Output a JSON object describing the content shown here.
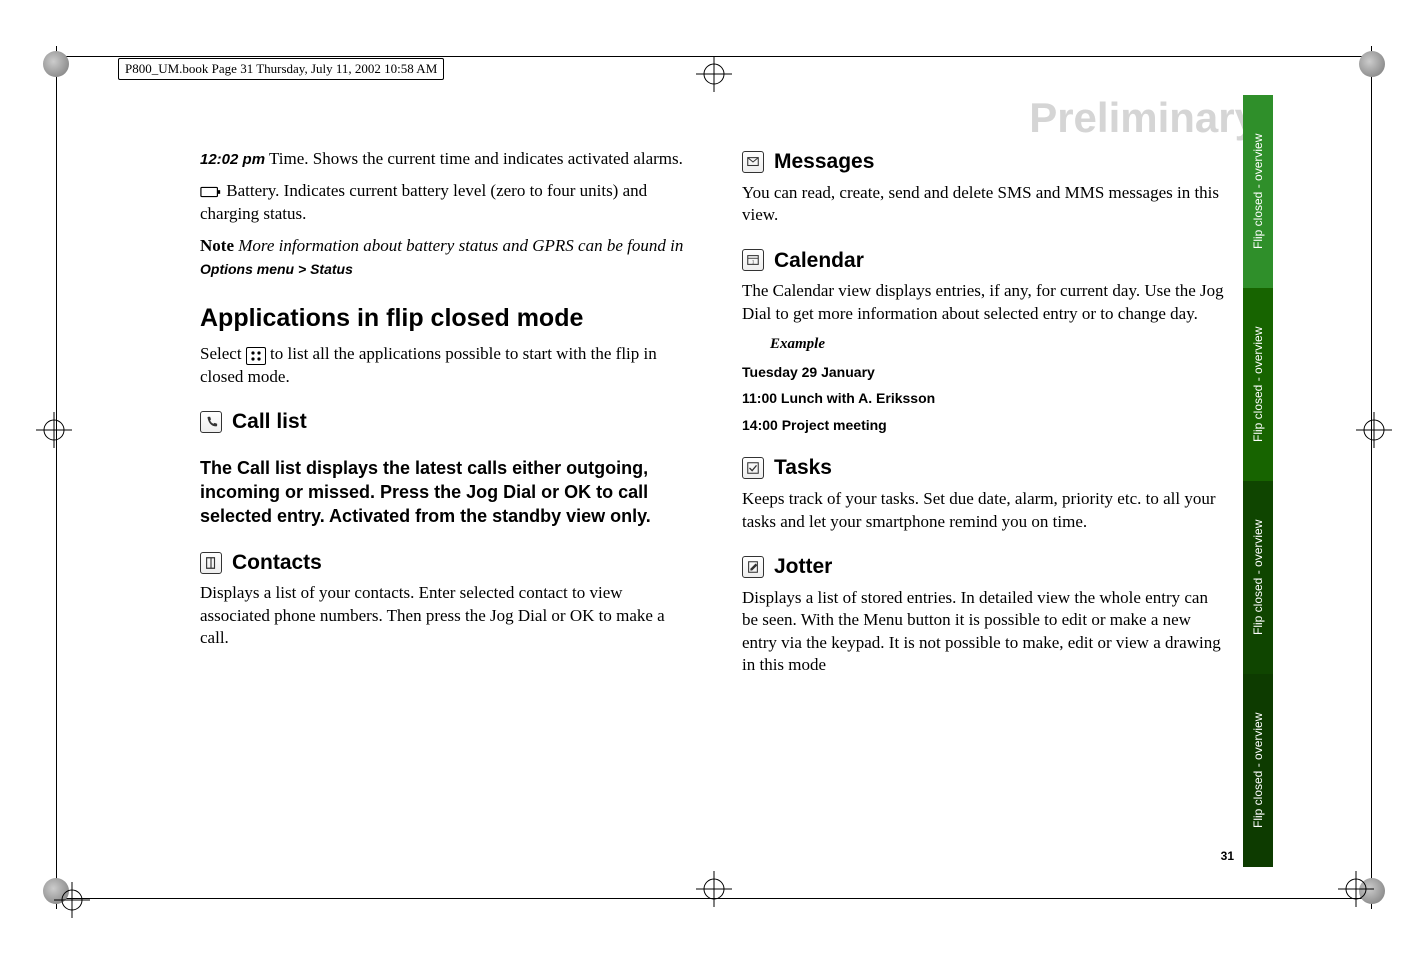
{
  "running_header": "P800_UM.book  Page 31  Thursday, July 11, 2002  10:58 AM",
  "watermark": "Preliminary",
  "page_number": "31",
  "side_tabs": {
    "t1": "Flip closed - overview",
    "t2": "Flip closed - overview",
    "t3": "Flip closed - overview",
    "t4": "Flip closed - overview"
  },
  "left": {
    "time_label": "12:02 pm",
    "time_text": " Time. Shows the current time and indicates activated alarms.",
    "battery_text": " Battery. Indicates current battery level (zero to four units) and charging status.",
    "note_word": "Note",
    "note_italic_a": " More information about battery status and GPRS can be found in ",
    "note_menu": "Options menu > Status",
    "h2": "Applications in flip closed mode",
    "select_a": "Select ",
    "select_b": " to list all the applications possible to start with the flip in closed mode.",
    "calllist_h": "Call list",
    "calllist_body": "The Call list displays the latest calls either outgoing, incoming or missed. Press the Jog Dial or OK to call selected entry. Activated from the standby view only.",
    "contacts_h": "Contacts",
    "contacts_body": "Displays a list of your contacts. Enter selected contact to view associated phone numbers. Then press the Jog Dial or OK to make a call."
  },
  "right": {
    "messages_h": "Messages",
    "messages_body": "You can read, create, send and delete SMS and MMS messages in this view.",
    "calendar_h": "Calendar",
    "calendar_body": "The Calendar view displays entries, if any, for current day. Use the Jog Dial to get more information about selected entry or to change day.",
    "example_label": "Example",
    "ex1": "Tuesday 29 January",
    "ex2": "11:00 Lunch with A. Eriksson",
    "ex3": "14:00 Project meeting",
    "tasks_h": "Tasks",
    "tasks_body": "Keeps track of your tasks. Set due date, alarm, priority etc. to all your tasks and let your smartphone remind you on time.",
    "jotter_h": "Jotter",
    "jotter_body": "Displays a list of stored entries. In detailed view the whole entry can be seen. With the Menu button it is possible to edit or make a new entry via the keypad. It is not possible to make, edit or view a drawing in this mode"
  }
}
